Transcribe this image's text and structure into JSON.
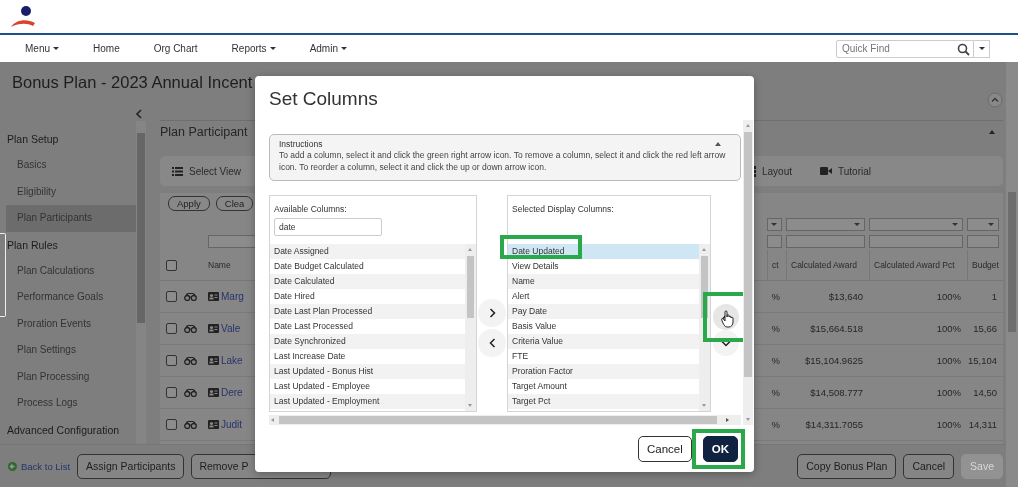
{
  "nav": {
    "items": [
      {
        "label": "Menu",
        "dropdown": true
      },
      {
        "label": "Home",
        "dropdown": false
      },
      {
        "label": "Org Chart",
        "dropdown": false
      },
      {
        "label": "Reports",
        "dropdown": true
      },
      {
        "label": "Admin",
        "dropdown": true
      }
    ],
    "quick_find": {
      "placeholder": "Quick Find"
    }
  },
  "page": {
    "title": "Bonus Plan - 2023 Annual Incent"
  },
  "sidebar": {
    "sections": [
      {
        "label": "Plan Setup",
        "children": [
          {
            "label": "Basics",
            "selected": false
          },
          {
            "label": "Eligibility",
            "selected": false
          },
          {
            "label": "Plan Participants",
            "selected": true
          }
        ]
      },
      {
        "label": "Plan Rules",
        "children": [
          {
            "label": "Plan Calculations",
            "selected": false
          },
          {
            "label": "Performance Goals",
            "selected": false
          },
          {
            "label": "Proration Events",
            "selected": false
          },
          {
            "label": "Plan Settings",
            "selected": false
          },
          {
            "label": "Plan Processing",
            "selected": false
          },
          {
            "label": "Process Logs",
            "selected": false
          }
        ]
      },
      {
        "label": "Advanced Configuration"
      }
    ]
  },
  "panel": {
    "title": "Plan Participant",
    "toolbar": [
      {
        "label": "Select View"
      },
      {
        "label": "Layout"
      },
      {
        "label": "Tutorial"
      }
    ],
    "select_all_checked": false,
    "filter_buttons": [
      "Apply",
      "Clea"
    ],
    "columns": [
      "Name",
      "ct",
      "Calculated Award",
      "Calculated Award Pct",
      "Budget"
    ],
    "rows": [
      {
        "checked": false,
        "cells": [
          "Marg",
          "%",
          "$13,640",
          "100%",
          "1"
        ]
      },
      {
        "checked": false,
        "cells": [
          "Vale",
          "%",
          "$15,664.518",
          "100%",
          "15,66"
        ]
      },
      {
        "checked": false,
        "cells": [
          "Lake",
          "%",
          "$15,104.9625",
          "100%",
          "15,104"
        ]
      },
      {
        "checked": false,
        "cells": [
          "Dere",
          "%",
          "$14,508.777",
          "100%",
          "14,50"
        ]
      },
      {
        "checked": false,
        "cells": [
          "Judit",
          "%",
          "$14,311.7055",
          "100%",
          "14,311"
        ]
      }
    ]
  },
  "footer": {
    "back_link": "Back to List",
    "left_buttons": [
      "Assign Participants",
      "Remove P"
    ],
    "right_buttons": [
      {
        "label": "Copy Bonus Plan",
        "disabled": false
      },
      {
        "label": "Cancel",
        "disabled": false
      },
      {
        "label": "Save",
        "disabled": true
      }
    ]
  },
  "modal": {
    "title": "Set Columns",
    "instructions": {
      "title": "Instructions",
      "text": "To add a column, select it and click the green right arrow icon. To remove a column, select it and click the red left arrow icon. To reorder a column, select it and click the up or down arrow icon.",
      "expanded": true
    },
    "available": {
      "label": "Available Columns:",
      "filter": "date",
      "items": [
        {
          "label": "Date Assigned",
          "selected": false
        },
        {
          "label": "Date Budget Calculated",
          "selected": false
        },
        {
          "label": "Date Calculated",
          "selected": false
        },
        {
          "label": "Date Hired",
          "selected": false
        },
        {
          "label": "Date Last Plan Processed",
          "selected": false
        },
        {
          "label": "Date Last Processed",
          "selected": false
        },
        {
          "label": "Date Synchronized",
          "selected": false
        },
        {
          "label": "Last Increase Date",
          "selected": false
        },
        {
          "label": "Last Updated - Bonus Hist",
          "selected": false
        },
        {
          "label": "Last Updated - Employee",
          "selected": false
        },
        {
          "label": "Last Updated - Employment",
          "selected": false
        }
      ]
    },
    "selected_columns": {
      "label": "Selected Display Columns:",
      "items": [
        {
          "label": "Date Updated",
          "selected": true,
          "highlighted": true
        },
        {
          "label": "View Details",
          "selected": false,
          "highlighted": false
        },
        {
          "label": "Name",
          "selected": false,
          "highlighted": false
        },
        {
          "label": "Alert",
          "selected": false,
          "highlighted": false
        },
        {
          "label": "Pay Date",
          "selected": false,
          "highlighted": false
        },
        {
          "label": "Basis Value",
          "selected": false,
          "highlighted": false
        },
        {
          "label": "Criteria Value",
          "selected": false,
          "highlighted": false
        },
        {
          "label": "FTE",
          "selected": false,
          "highlighted": false
        },
        {
          "label": "Proration Factor",
          "selected": false,
          "highlighted": false
        },
        {
          "label": "Target Amount",
          "selected": false,
          "highlighted": false
        },
        {
          "label": "Target Pct",
          "selected": false,
          "highlighted": false
        }
      ]
    },
    "move_up_highlighted": true,
    "buttons": [
      {
        "label": "Cancel",
        "kind": "secondary",
        "highlighted": false
      },
      {
        "label": "OK",
        "kind": "primary",
        "highlighted": true
      }
    ]
  }
}
